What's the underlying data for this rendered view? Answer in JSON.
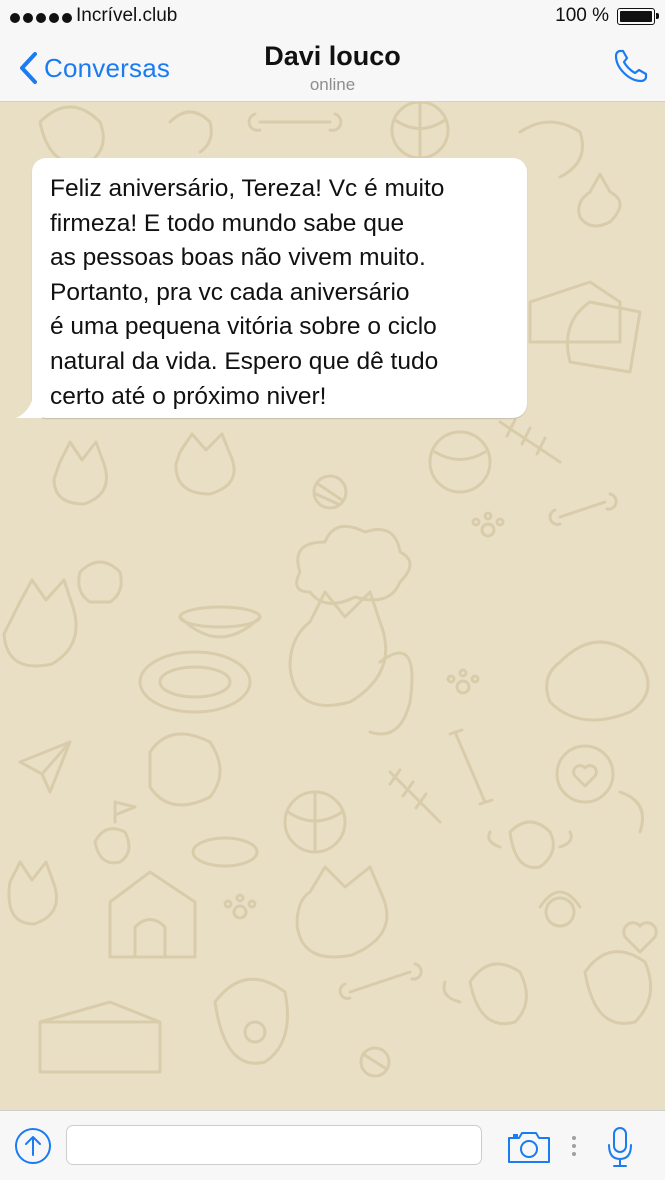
{
  "status_bar": {
    "carrier": "Incrível.club",
    "battery_percent": "100 %",
    "battery_level": 1.0,
    "signal_bars": 5
  },
  "nav": {
    "back_label": "Conversas",
    "contact_name": "Davi louco",
    "contact_status": "online",
    "back_icon": "chevron-left-icon",
    "call_icon": "phone-icon"
  },
  "messages": [
    {
      "direction": "incoming",
      "text": "Feliz aniversário, Tereza! Vc é muito\nfirmeza! E todo mundo sabe que\nas pessoas boas não vivem muito.\nPortanto, pra vc cada aniversário\né uma pequena vitória sobre o ciclo\nnatural da vida. Espero que dê tudo\ncerto até o próximo niver!"
    }
  ],
  "input_bar": {
    "message_value": "",
    "attach_icon": "upload-arrow-icon",
    "camera_icon": "camera-icon",
    "mic_icon": "microphone-icon"
  },
  "colors": {
    "accent": "#1a7cf0",
    "wallpaper": "#e9dfc4",
    "doodle": "#d9ccaa",
    "bar_background": "#f7f7f7",
    "bubble": "#ffffff"
  }
}
